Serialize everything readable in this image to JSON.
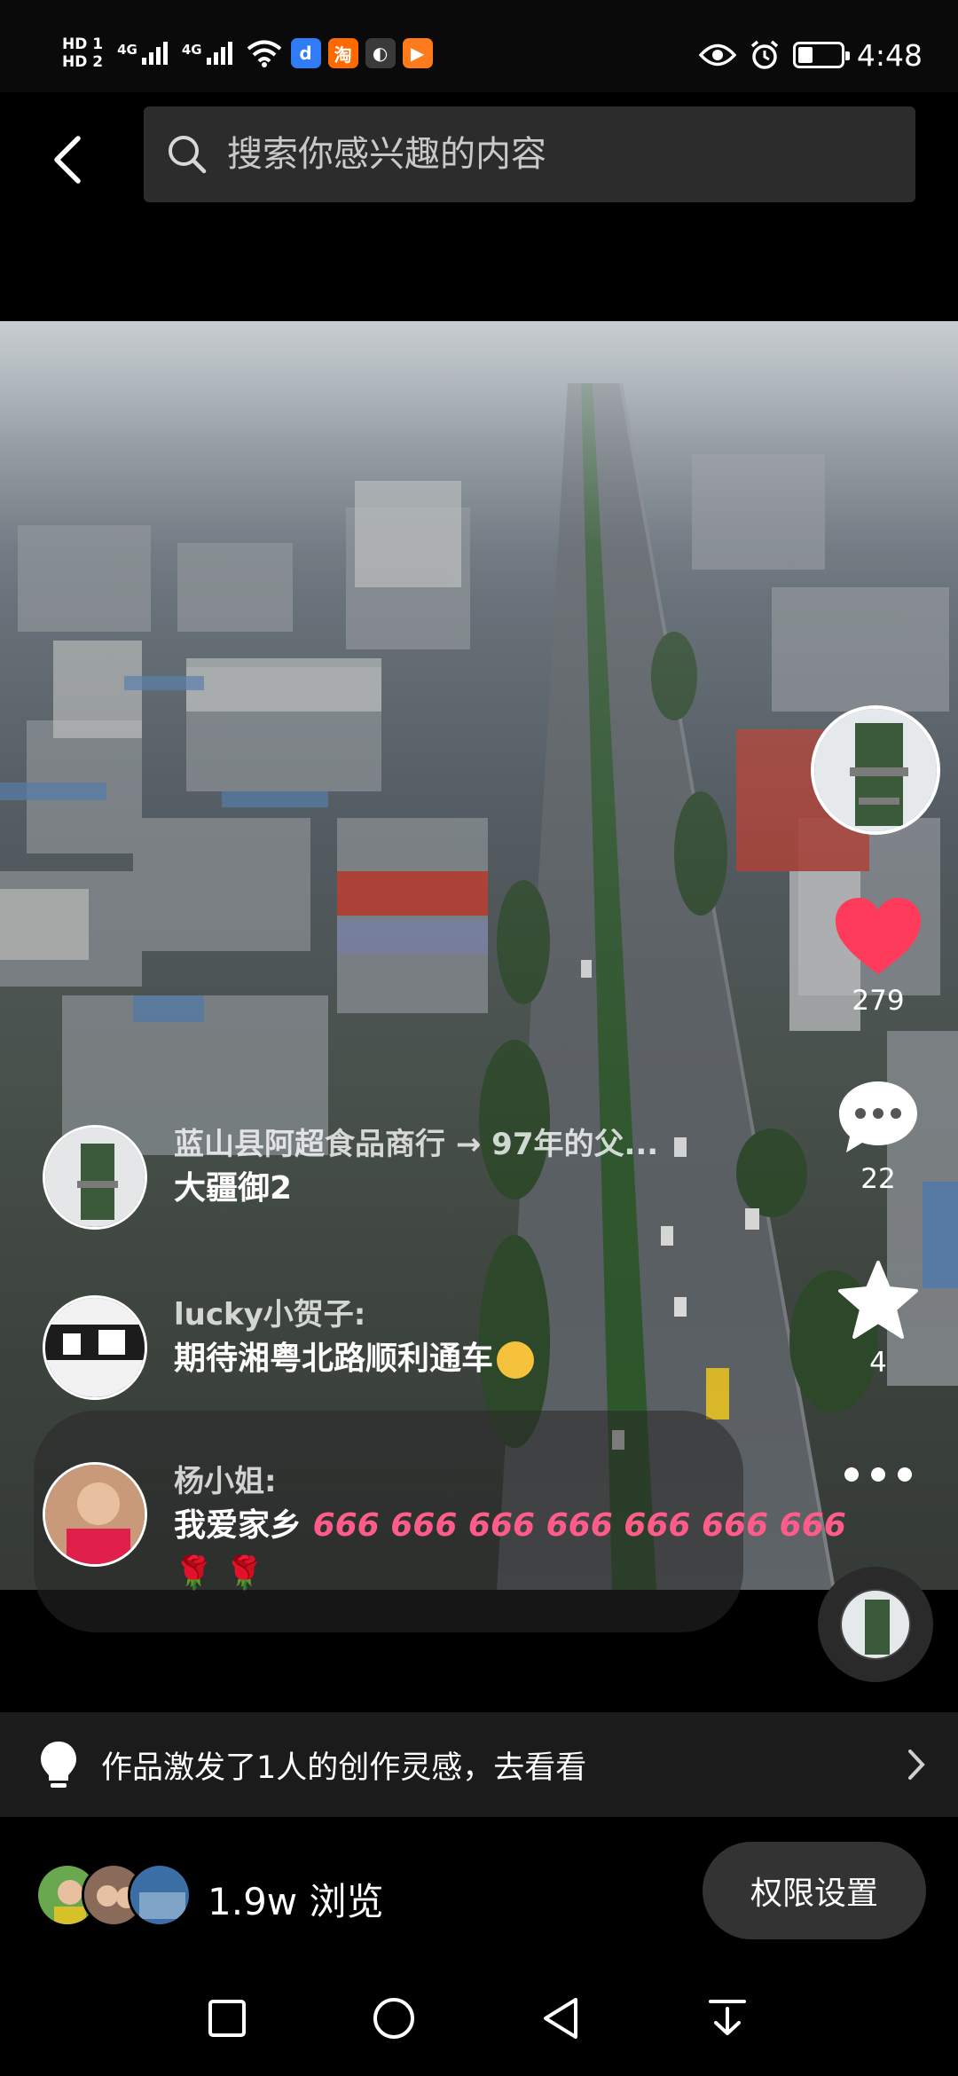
{
  "status_bar": {
    "hd1": "HD 1",
    "hd2": "HD 2",
    "net1": "4G",
    "net2": "4G",
    "time": "4:48",
    "app_icons": [
      {
        "name": "app-icon-blue",
        "glyph": "d",
        "color": "#2f7cf6"
      },
      {
        "name": "app-icon-taobao",
        "glyph": "淘",
        "color": "#ff6a00"
      },
      {
        "name": "app-icon-ball",
        "glyph": "◐",
        "color": "#3a3a3a"
      },
      {
        "name": "app-icon-play",
        "glyph": "▶",
        "color": "#ff7a1a"
      }
    ],
    "battery_level": 0.35
  },
  "search": {
    "placeholder": "搜索你感兴趣的内容"
  },
  "comments": [
    {
      "user": "蓝山县阿超食品商行 → 97年的父...",
      "text": "大疆御2"
    },
    {
      "user": "lucky小贺子:",
      "text": "期待湘粤北路顺利通车"
    },
    {
      "user": "杨小姐:",
      "text": "我爱家乡",
      "pink": "666 666 666 666 666 666 666",
      "roses": "🌹 🌹"
    }
  ],
  "actions": {
    "likes": "279",
    "comments": "22",
    "favorites": "4"
  },
  "inspiration": {
    "text": "作品激发了1人的创作灵感，去看看"
  },
  "stats": {
    "views": "1.9w 浏览",
    "permission_button": "权限设置"
  },
  "colors": {
    "like": "#ff3b5c",
    "pink_text": "#ff5c8a",
    "background": "#000000"
  }
}
